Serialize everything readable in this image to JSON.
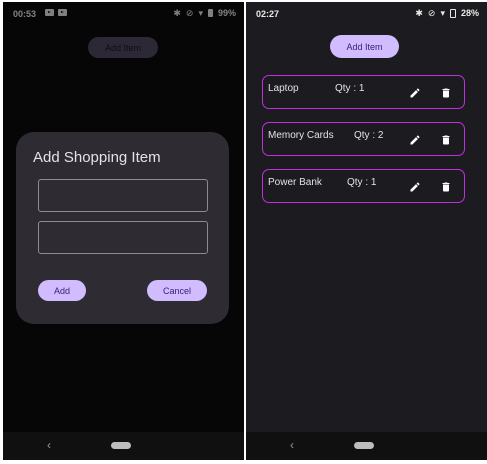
{
  "left_screen": {
    "status": {
      "time": "00:53",
      "battery": "99%"
    },
    "add_item_label": "Add Item",
    "dialog": {
      "title": "Add Shopping Item",
      "name_value": "",
      "qty_value": "",
      "add_label": "Add",
      "cancel_label": "Cancel"
    },
    "nav": {
      "back_glyph": "‹"
    }
  },
  "right_screen": {
    "status": {
      "time": "02:27",
      "battery": "28%"
    },
    "add_item_label": "Add Item",
    "items": [
      {
        "name": "Laptop",
        "qty_label": "Qty : 1"
      },
      {
        "name": "Memory Cards",
        "qty_label": "Qty : 2"
      },
      {
        "name": "Power Bank",
        "qty_label": "Qty : 1"
      }
    ],
    "nav": {
      "back_glyph": "‹"
    }
  },
  "colors": {
    "accent": "#d0bcff",
    "on_accent": "#381e72",
    "card_border": "#c030e0",
    "background": "#1c1b1f",
    "dialog_surface": "#2e2b33"
  },
  "icons": {
    "edit": "pencil-icon",
    "delete": "trash-icon",
    "bluetooth": "bluetooth-icon",
    "mute": "bell-off-icon",
    "wifi": "wifi-icon",
    "battery": "battery-icon"
  }
}
